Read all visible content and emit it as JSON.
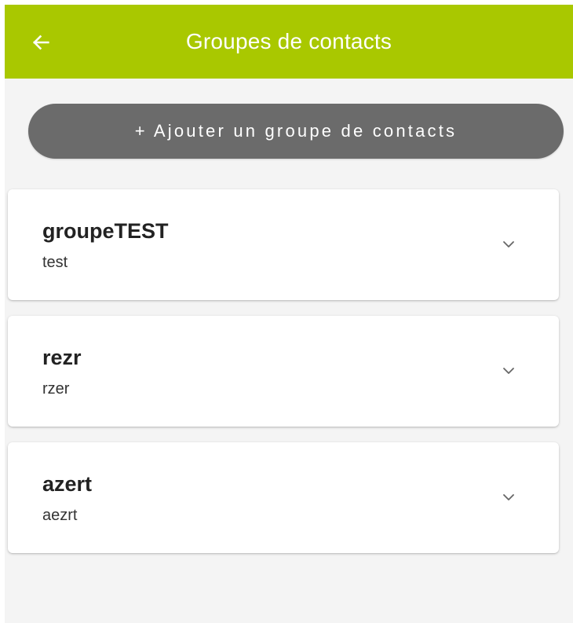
{
  "header": {
    "title": "Groupes de contacts",
    "back_icon": "arrow-left-icon",
    "background_color": "#a9c800"
  },
  "actions": {
    "add_group_label": "+ Ajouter un groupe de contacts",
    "button_color": "#6b6b6b"
  },
  "groups": [
    {
      "name": "groupeTEST",
      "description": "test",
      "icon": "chevron-down-icon"
    },
    {
      "name": "rezr",
      "description": "rzer",
      "icon": "chevron-down-icon"
    },
    {
      "name": "azert",
      "description": "aezrt",
      "icon": "chevron-down-icon"
    }
  ]
}
